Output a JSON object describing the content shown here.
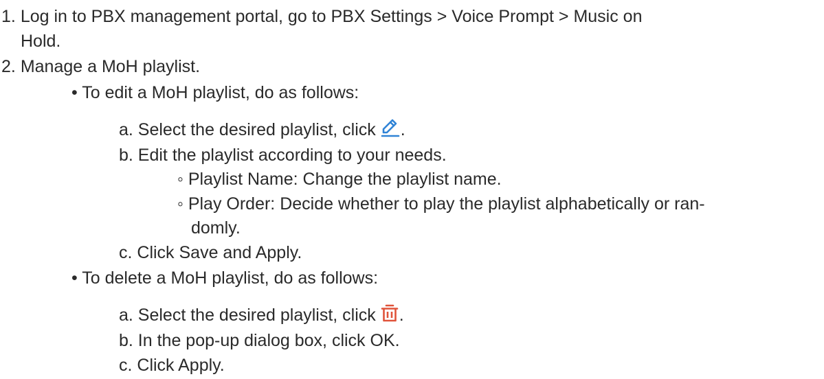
{
  "steps": [
    {
      "number": "1.",
      "line1": "Log in to PBX management portal, go to PBX Settings > Voice Prompt > Music on",
      "line2": "Hold."
    },
    {
      "number": "2.",
      "text": "Manage a MoH playlist."
    }
  ],
  "edit": {
    "bullet": "•",
    "intro": "To edit a MoH playlist, do as follows:",
    "a": {
      "prefix": "a. Select the desired playlist, click",
      "suffix": "."
    },
    "b": {
      "text": "b. Edit the playlist according to your needs."
    },
    "sub": [
      {
        "marker": "◦",
        "text": "Playlist Name: Change the playlist name."
      },
      {
        "marker": "◦",
        "line1": "Play Order: Decide whether to play the playlist alphabetically or ran-",
        "line2": "domly."
      }
    ],
    "c": {
      "text": "c. Click Save and Apply."
    },
    "icon": {
      "name": "edit-pencil-icon",
      "color": "#2f83d6"
    }
  },
  "delete": {
    "bullet": "•",
    "intro": "To delete a MoH playlist, do as follows:",
    "a": {
      "prefix": "a. Select the desired playlist, click",
      "suffix": "."
    },
    "b": {
      "text": "b. In the pop-up dialog box, click OK."
    },
    "c": {
      "text": "c. Click Apply."
    },
    "icon": {
      "name": "trash-icon",
      "color": "#e0533a"
    }
  }
}
